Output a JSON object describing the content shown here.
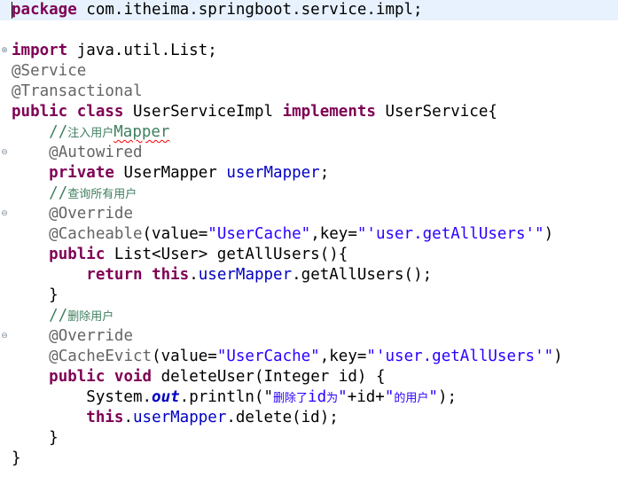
{
  "editor": {
    "lines": [
      {
        "tokens": [
          {
            "t": "package",
            "c": "kw"
          },
          {
            "t": " com.itheima.springboot.service.impl;"
          }
        ]
      },
      {
        "tokens": []
      },
      {
        "tokens": [
          {
            "t": "import",
            "c": "kw"
          },
          {
            "t": " java.util.List;"
          }
        ]
      },
      {
        "tokens": [
          {
            "t": "@Service",
            "c": "ann"
          }
        ]
      },
      {
        "tokens": [
          {
            "t": "@Transactional",
            "c": "ann"
          }
        ]
      },
      {
        "tokens": [
          {
            "t": "public",
            "c": "kw"
          },
          {
            "t": " "
          },
          {
            "t": "class",
            "c": "kw"
          },
          {
            "t": " UserServiceImpl "
          },
          {
            "t": "implements",
            "c": "kw"
          },
          {
            "t": " UserService{"
          }
        ]
      },
      {
        "tokens": [
          {
            "t": "    "
          },
          {
            "t": "//",
            "c": "cmt"
          },
          {
            "t": "注入用户",
            "c": "cmt cjk"
          },
          {
            "t": "Mapper",
            "c": "cmt squiggle"
          }
        ]
      },
      {
        "tokens": [
          {
            "t": "    "
          },
          {
            "t": "@Autowired",
            "c": "ann"
          }
        ]
      },
      {
        "tokens": [
          {
            "t": "    "
          },
          {
            "t": "private",
            "c": "kw"
          },
          {
            "t": " UserMapper "
          },
          {
            "t": "userMapper",
            "c": "fld"
          },
          {
            "t": ";"
          }
        ]
      },
      {
        "tokens": [
          {
            "t": "    "
          },
          {
            "t": "//",
            "c": "cmt"
          },
          {
            "t": "查询所有用户",
            "c": "cmt cjk"
          }
        ]
      },
      {
        "tokens": [
          {
            "t": "    "
          },
          {
            "t": "@Override",
            "c": "ann"
          }
        ]
      },
      {
        "tokens": [
          {
            "t": "    "
          },
          {
            "t": "@Cacheable",
            "c": "ann"
          },
          {
            "t": "(value="
          },
          {
            "t": "\"UserCache\"",
            "c": "str"
          },
          {
            "t": ",key="
          },
          {
            "t": "\"'user.getAllUsers'\"",
            "c": "str"
          },
          {
            "t": ")"
          }
        ]
      },
      {
        "tokens": [
          {
            "t": "    "
          },
          {
            "t": "public",
            "c": "kw"
          },
          {
            "t": " List<User> getAllUsers(){"
          }
        ]
      },
      {
        "tokens": [
          {
            "t": "        "
          },
          {
            "t": "return",
            "c": "kw"
          },
          {
            "t": " "
          },
          {
            "t": "this",
            "c": "kw"
          },
          {
            "t": "."
          },
          {
            "t": "userMapper",
            "c": "fld"
          },
          {
            "t": ".getAllUsers();"
          }
        ]
      },
      {
        "tokens": [
          {
            "t": "    }"
          }
        ]
      },
      {
        "tokens": [
          {
            "t": "    "
          },
          {
            "t": "//",
            "c": "cmt"
          },
          {
            "t": "删除用户",
            "c": "cmt cjk"
          }
        ]
      },
      {
        "tokens": [
          {
            "t": "    "
          },
          {
            "t": "@Override",
            "c": "ann"
          }
        ]
      },
      {
        "tokens": [
          {
            "t": "    "
          },
          {
            "t": "@CacheEvict",
            "c": "ann"
          },
          {
            "t": "(value="
          },
          {
            "t": "\"UserCache\"",
            "c": "str"
          },
          {
            "t": ",key="
          },
          {
            "t": "\"'user.getAllUsers'\"",
            "c": "str"
          },
          {
            "t": ")"
          }
        ]
      },
      {
        "tokens": [
          {
            "t": "    "
          },
          {
            "t": "public",
            "c": "kw"
          },
          {
            "t": " "
          },
          {
            "t": "void",
            "c": "kw"
          },
          {
            "t": " deleteUser(Integer id) {"
          }
        ]
      },
      {
        "tokens": [
          {
            "t": "        System."
          },
          {
            "t": "out",
            "c": "sfld"
          },
          {
            "t": ".println("
          },
          {
            "t": "\""
          },
          {
            "t": "删除了",
            "c": "str cjk"
          },
          {
            "t": "id",
            "c": "str"
          },
          {
            "t": "为",
            "c": "str cjk"
          },
          {
            "t": "\"",
            "c": "str"
          },
          {
            "t": "+id+"
          },
          {
            "t": "\"",
            "c": "str"
          },
          {
            "t": "的用户",
            "c": "str cjk"
          },
          {
            "t": "\"",
            "c": "str"
          },
          {
            "t": ");"
          }
        ]
      },
      {
        "tokens": [
          {
            "t": "        "
          },
          {
            "t": "this",
            "c": "kw"
          },
          {
            "t": "."
          },
          {
            "t": "userMapper",
            "c": "fld"
          },
          {
            "t": ".delete(id);"
          }
        ]
      },
      {
        "tokens": [
          {
            "t": "    }"
          }
        ]
      },
      {
        "tokens": [
          {
            "t": "}"
          }
        ]
      }
    ],
    "fold_markers": [
      {
        "line": 2,
        "symbol": "⊕"
      },
      {
        "line": 7,
        "symbol": "⊖"
      },
      {
        "line": 10,
        "symbol": "⊖"
      },
      {
        "line": 16,
        "symbol": "⊖"
      }
    ]
  }
}
